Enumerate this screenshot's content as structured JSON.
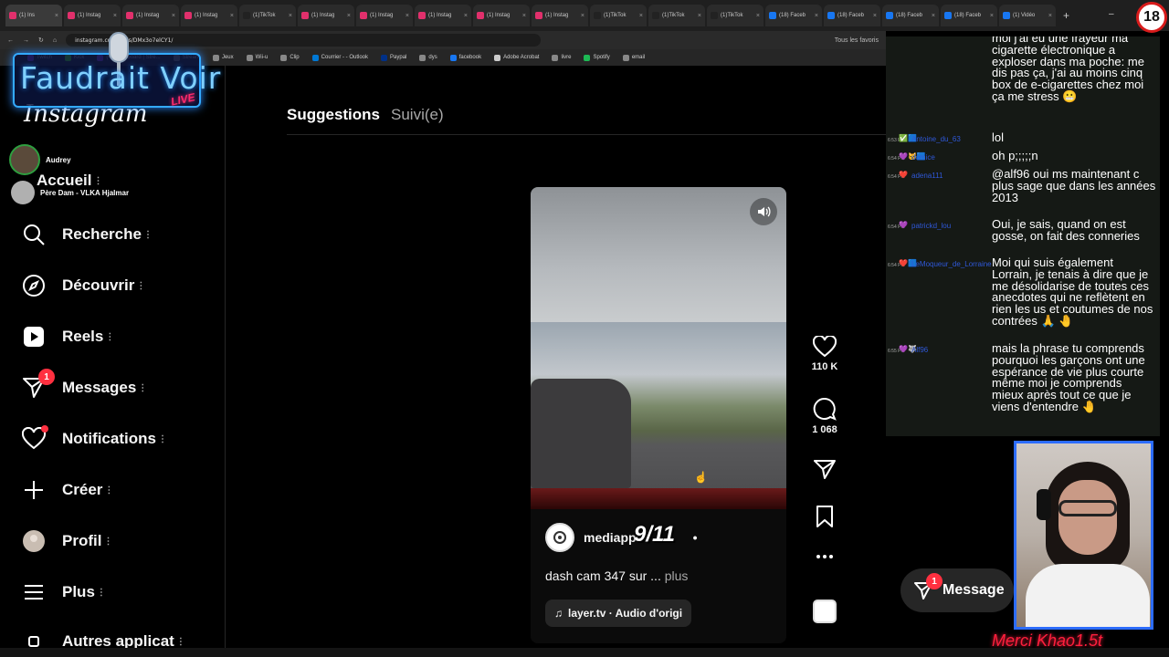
{
  "browser": {
    "tabs": [
      {
        "label": "(1) Ins",
        "color": "#e1306c",
        "active": true
      },
      {
        "label": "(1) Instag",
        "color": "#e1306c"
      },
      {
        "label": "(1) Instag",
        "color": "#e1306c"
      },
      {
        "label": "(1) Instag",
        "color": "#e1306c"
      },
      {
        "label": "(1)TikTok",
        "color": "#222222"
      },
      {
        "label": "(1) Instag",
        "color": "#e1306c"
      },
      {
        "label": "(1) Instag",
        "color": "#e1306c"
      },
      {
        "label": "(1) Instag",
        "color": "#e1306c"
      },
      {
        "label": "(1) Instag",
        "color": "#e1306c"
      },
      {
        "label": "(1) Instag",
        "color": "#e1306c"
      },
      {
        "label": "(1)TikTok",
        "color": "#222222"
      },
      {
        "label": "(1)TikTok",
        "color": "#222222"
      },
      {
        "label": "(1)TikTok",
        "color": "#222222"
      },
      {
        "label": "(18) Faceb",
        "color": "#1877f2"
      },
      {
        "label": "(18) Faceb",
        "color": "#1877f2"
      },
      {
        "label": "(18) Faceb",
        "color": "#1877f2"
      },
      {
        "label": "(18) Faceb",
        "color": "#1877f2"
      },
      {
        "label": "(1) Vidéo",
        "color": "#1877f2"
      }
    ],
    "url": "instagram.com/reels/DMx3o7elCY1/",
    "bookmarks": [
      {
        "label": "Twitch",
        "color": "#9146ff"
      },
      {
        "label": "Kick",
        "color": "#53fc18"
      },
      {
        "label": "(4) Dashboard | Stre...",
        "color": "#9146ff"
      },
      {
        "label": "Stream",
        "color": "#888888"
      },
      {
        "label": "Jeux",
        "color": "#888888"
      },
      {
        "label": "Wii-u",
        "color": "#888888"
      },
      {
        "label": "Clip",
        "color": "#888888"
      },
      {
        "label": "Courrier - - Outlook",
        "color": "#0078d4"
      },
      {
        "label": "Paypal",
        "color": "#003087"
      },
      {
        "label": "dys",
        "color": "#888888"
      },
      {
        "label": "facebook",
        "color": "#1877f2"
      },
      {
        "label": "Adobe Acrobat",
        "color": "#cccccc"
      },
      {
        "label": "livre",
        "color": "#888888"
      },
      {
        "label": "Spotify",
        "color": "#1db954"
      },
      {
        "label": "email",
        "color": "#888888"
      }
    ],
    "all_bookmarks": "Tous les favoris"
  },
  "overlay": {
    "logo_text": "Faudrait Voir",
    "live_text": "LIVE",
    "age_badge": "18",
    "thanks_text": "Merci Khao1.5t"
  },
  "sidebar": {
    "logo": "Instagram",
    "mini_users": [
      {
        "name": "Audrey"
      },
      {
        "name": "Père Dam - VLKA Hjalmar"
      }
    ],
    "items": [
      {
        "label": "Accueil",
        "icon": "home-icon"
      },
      {
        "label": "Recherche",
        "icon": "search-icon"
      },
      {
        "label": "Découvrir",
        "icon": "compass-icon"
      },
      {
        "label": "Reels",
        "icon": "reels-icon"
      },
      {
        "label": "Messages",
        "icon": "messages-icon",
        "badge": "1"
      },
      {
        "label": "Notifications",
        "icon": "heart-icon"
      },
      {
        "label": "Créer",
        "icon": "plus-icon"
      },
      {
        "label": "Profil",
        "icon": "avatar-icon"
      },
      {
        "label": "Plus",
        "icon": "menu-icon"
      },
      {
        "label": "Autres applicat",
        "icon": "apps-icon"
      }
    ]
  },
  "feed": {
    "tab_suggestions": "Suggestions",
    "tab_following": "Suivi(e)"
  },
  "reel": {
    "username": "mediapp",
    "username_tail": "•",
    "caption": "dash cam 347 sur ...",
    "caption_more": "plus",
    "audio": "layer.tv · Audio d'origi",
    "counter": "9/11",
    "likes": "110 K",
    "comments": "1 068"
  },
  "messages_pill": {
    "label": "Message",
    "badge": "1"
  },
  "chat": [
    {
      "time": "",
      "icons": "",
      "user": "",
      "text": "moi j'ai eu une frayeur ma cigarette électronique a exploser dans ma poche: me dis pas ça, j'ai au moins cinq box de e-cigarettes chez moi ça me stress 😬"
    },
    {
      "time": "6:53 PM",
      "icons": "✅🟦",
      "user": "Antoine_du_63",
      "text": "lol"
    },
    {
      "time": "6:54 PM",
      "icons": "💜🐱🟦",
      "user": "domice",
      "text": "oh p;;;;;n"
    },
    {
      "time": "6:54 PM",
      "icons": "❤️",
      "user": "adena111",
      "text": "@alf96 oui ms maintenant c plus sage que dans les années 2013"
    },
    {
      "time": "6:54 PM",
      "icons": "💜",
      "user": "patrickd_lou",
      "text": "Oui, je sais, quand on est gosse, on fait des conneries"
    },
    {
      "time": "6:54 PM",
      "icons": "❤️🟦",
      "user": "LeMoqueur_de_Lorraine",
      "text": "Moi qui suis également Lorrain, je tenais à dire que je me désolidarise de toutes ces anecdotes qui ne reflètent en rien les us et coutumes de nos contrées 🙏 🤚"
    },
    {
      "time": "6:55 PM",
      "icons": "💜🐺",
      "user": "Alf96",
      "text": "mais la phrase tu comprends pourquoi les garçons ont une espérance de vie plus courte même moi je comprends mieux après tout ce que je viens d'entendre 🤚"
    }
  ]
}
